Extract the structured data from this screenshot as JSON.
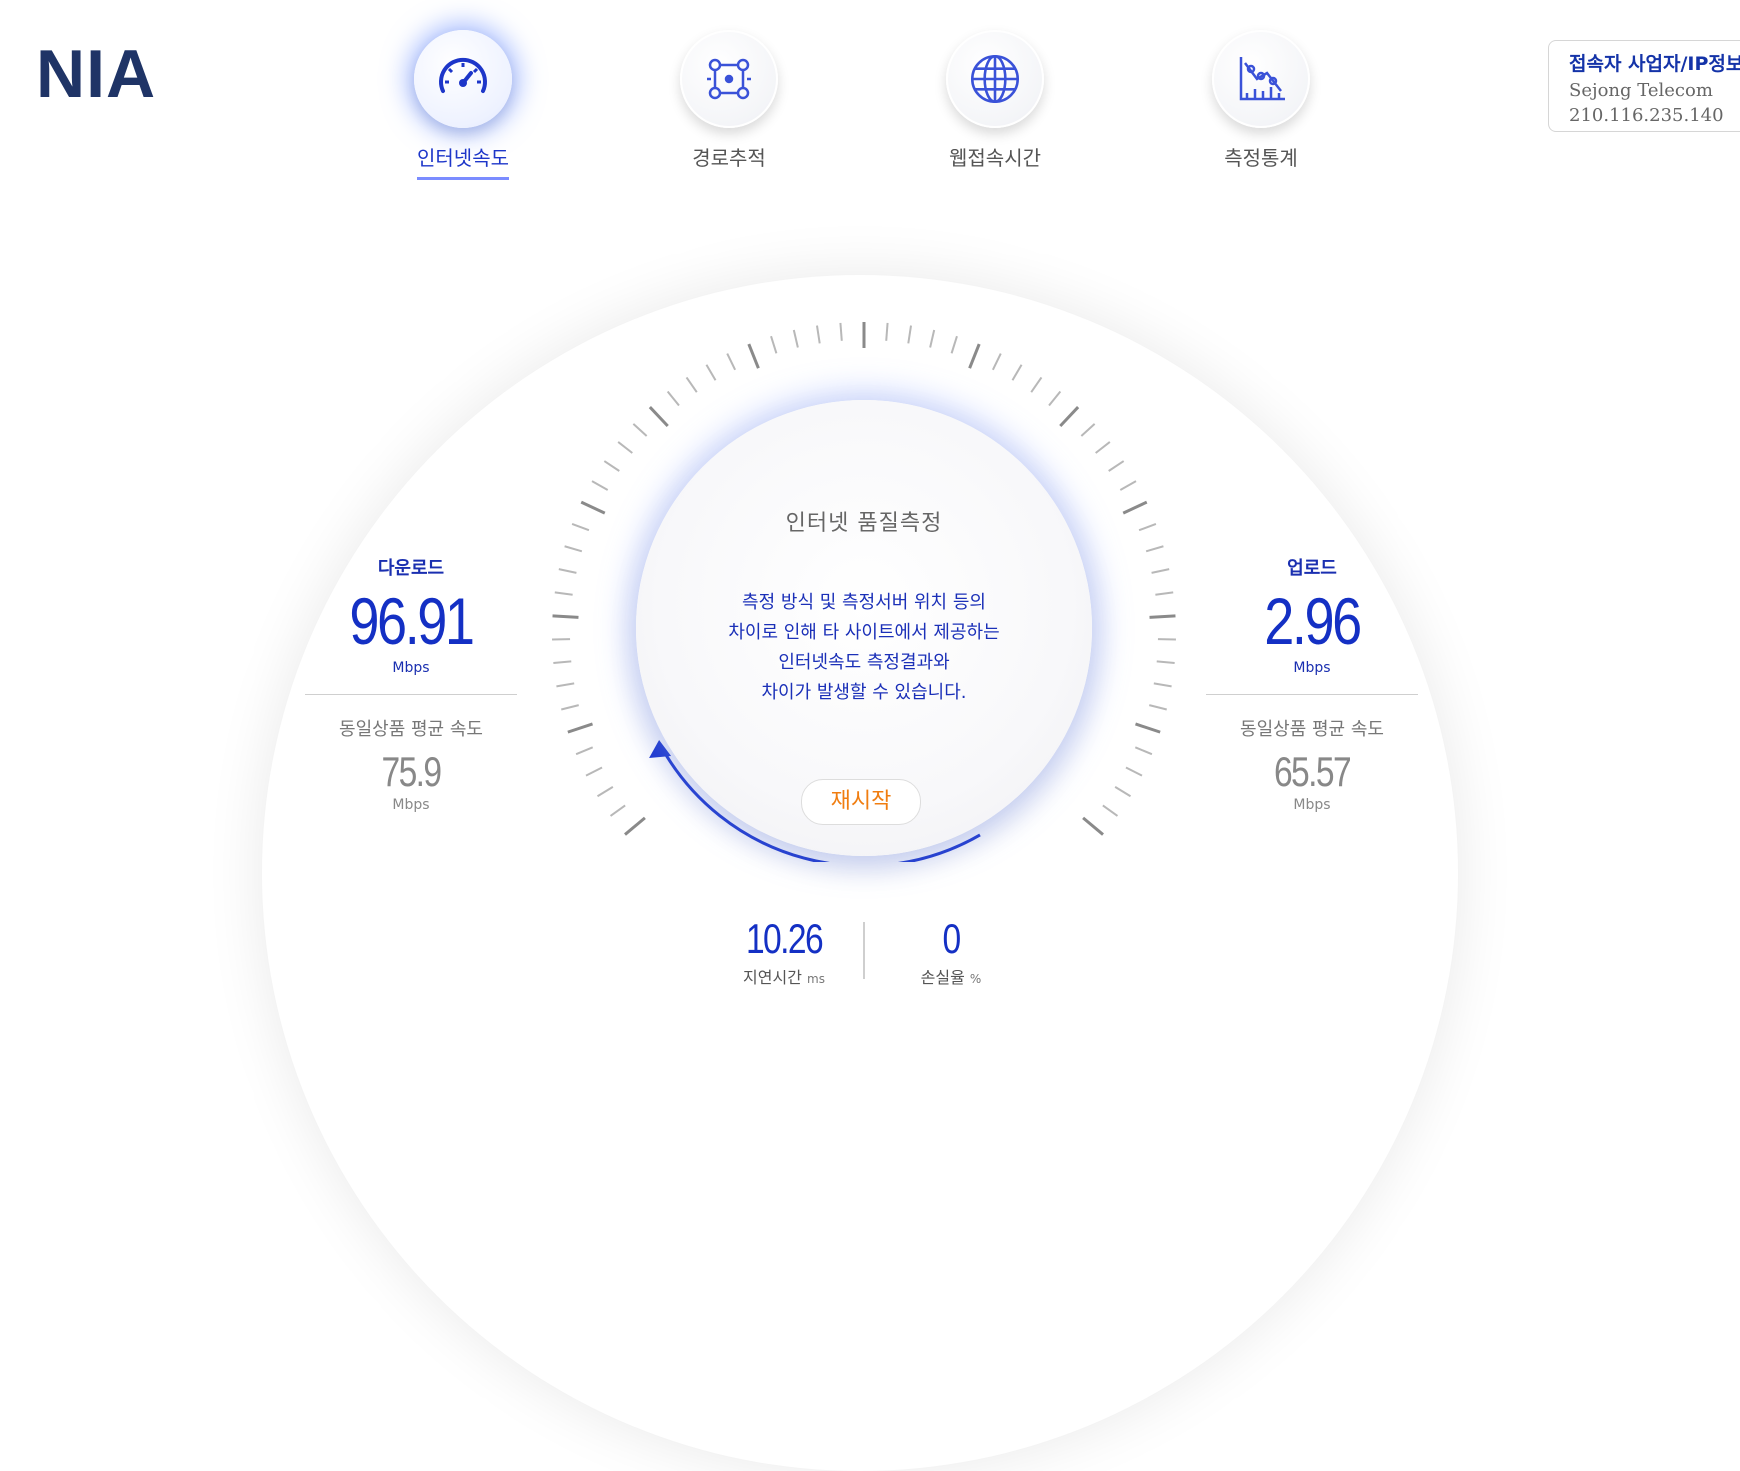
{
  "logo": "NIA",
  "nav": [
    {
      "label": "인터넷속도",
      "icon": "speedometer-icon",
      "active": true
    },
    {
      "label": "경로추적",
      "icon": "route-trace-icon",
      "active": false
    },
    {
      "label": "웹접속시간",
      "icon": "globe-icon",
      "active": false
    },
    {
      "label": "측정통계",
      "icon": "statistics-chart-icon",
      "active": false
    }
  ],
  "ip_info": {
    "title": "접속자 사업자/IP정보",
    "provider": "Sejong Telecom",
    "ip": "210.116.235.140"
  },
  "download": {
    "title": "다운로드",
    "value": "96.91",
    "unit": "Mbps",
    "avg_label": "동일상품 평균 속도",
    "avg_value": "75.9",
    "avg_unit": "Mbps"
  },
  "upload": {
    "title": "업로드",
    "value": "2.96",
    "unit": "Mbps",
    "avg_label": "동일상품 평균 속도",
    "avg_value": "65.57",
    "avg_unit": "Mbps"
  },
  "center": {
    "title": "인터넷 품질측정",
    "message": [
      "측정 방식 및 측정서버 위치 등의",
      "차이로 인해 타 사이트에서 제공하는",
      "인터넷속도 측정결과와",
      "차이가 발생할 수 있습니다."
    ],
    "restart": "재시작"
  },
  "latency": {
    "value": "10.26",
    "label": "지연시간",
    "unit": "ms"
  },
  "loss": {
    "value": "0",
    "label": "손실율",
    "unit": "%"
  },
  "colors": {
    "accent": "#1430c4",
    "brand": "#1f3466",
    "restart": "#f07d10"
  }
}
